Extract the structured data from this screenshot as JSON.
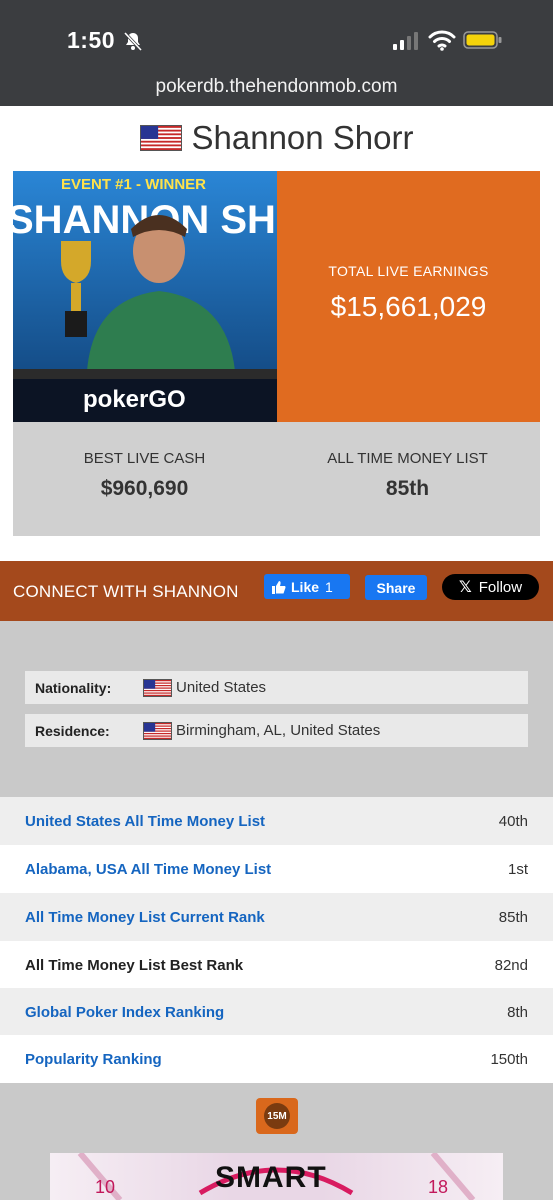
{
  "status_bar": {
    "time": "1:50"
  },
  "browser": {
    "url": "pokerdb.thehendonmob.com"
  },
  "player": {
    "name": "Shannon Shorr"
  },
  "photo": {
    "banner": "EVENT #1 - WINNER",
    "name_overlay": "SHANNON SHORR",
    "brand": "pokerGO"
  },
  "earnings": {
    "label": "TOTAL LIVE EARNINGS",
    "value": "$15,661,029"
  },
  "stats": {
    "best_cash_label": "BEST LIVE CASH",
    "best_cash_value": "$960,690",
    "money_list_label": "ALL TIME MONEY LIST",
    "money_list_value": "85th"
  },
  "connect": {
    "label": "CONNECT WITH SHANNON",
    "like_label": "Like",
    "like_count": "1",
    "share_label": "Share",
    "follow_label": "Follow"
  },
  "info": [
    {
      "key": "Nationality:",
      "value": "United States"
    },
    {
      "key": "Residence:",
      "value": "Birmingham, AL, United States"
    }
  ],
  "rankings": [
    {
      "label": "United States All Time Money List",
      "value": "40th"
    },
    {
      "label": "Alabama, USA All Time Money List",
      "value": "1st"
    },
    {
      "label": "All Time Money List Current Rank",
      "value": "85th"
    },
    {
      "label": "All Time Money List Best Rank",
      "value": "82nd"
    },
    {
      "label": "Global Poker Index Ranking",
      "value": "8th"
    },
    {
      "label": "Popularity Ranking",
      "value": "150th"
    }
  ],
  "badge": {
    "label": "15M"
  },
  "ad": {
    "text": "SMART",
    "left_num": "10",
    "right_num": "18"
  },
  "colors": {
    "orange": "#e06b20",
    "connect_bar": "#a4491c",
    "link": "#1565c0",
    "facebook": "#1877f2"
  }
}
